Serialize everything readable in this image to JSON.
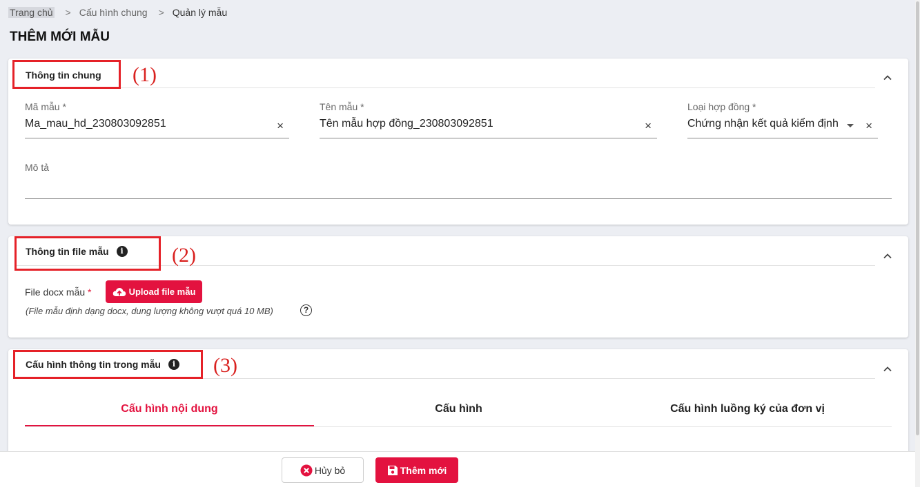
{
  "breadcrumb": {
    "home": "Trang chủ",
    "sep": ">",
    "level1": "Cấu hình chung",
    "current": "Quản lý mẫu"
  },
  "page_title": "THÊM MỚI MẪU",
  "section_general": {
    "title": "Thông tin chung",
    "annotation": "(1)",
    "code": {
      "label": "Mã mẫu *",
      "value": "Ma_mau_hd_230803092851"
    },
    "name": {
      "label": "Tên mẫu *",
      "value": "Tên mẫu hợp đồng_230803092851"
    },
    "contract_type": {
      "label": "Loại hợp đồng *",
      "value": "Chứng nhận kết quả kiểm định"
    },
    "description": {
      "label": "Mô tả",
      "value": ""
    },
    "clear_symbol": "×"
  },
  "section_file": {
    "title": "Thông tin file mẫu",
    "annotation": "(2)",
    "file_label": "File docx mẫu",
    "required_mark": "*",
    "upload_label": "Upload file mẫu",
    "hint": "(File mẫu định dạng docx, dung lượng không vượt quá 10 MB)",
    "help_symbol": "?",
    "info_symbol": "i"
  },
  "section_config": {
    "title": "Cấu hình thông tin trong mẫu",
    "annotation": "(3)",
    "info_symbol": "i",
    "tabs": [
      {
        "label": "Cấu hình nội dung",
        "active": true
      },
      {
        "label": "Cấu hình",
        "active": false
      },
      {
        "label": "Cấu hình luồng ký của đơn vị",
        "active": false
      }
    ]
  },
  "footer": {
    "cancel_label": "Hủy bỏ",
    "add_label": "Thêm mới"
  },
  "colors": {
    "accent": "#e3123f",
    "annotation": "#e52128",
    "background": "#eceef3"
  }
}
